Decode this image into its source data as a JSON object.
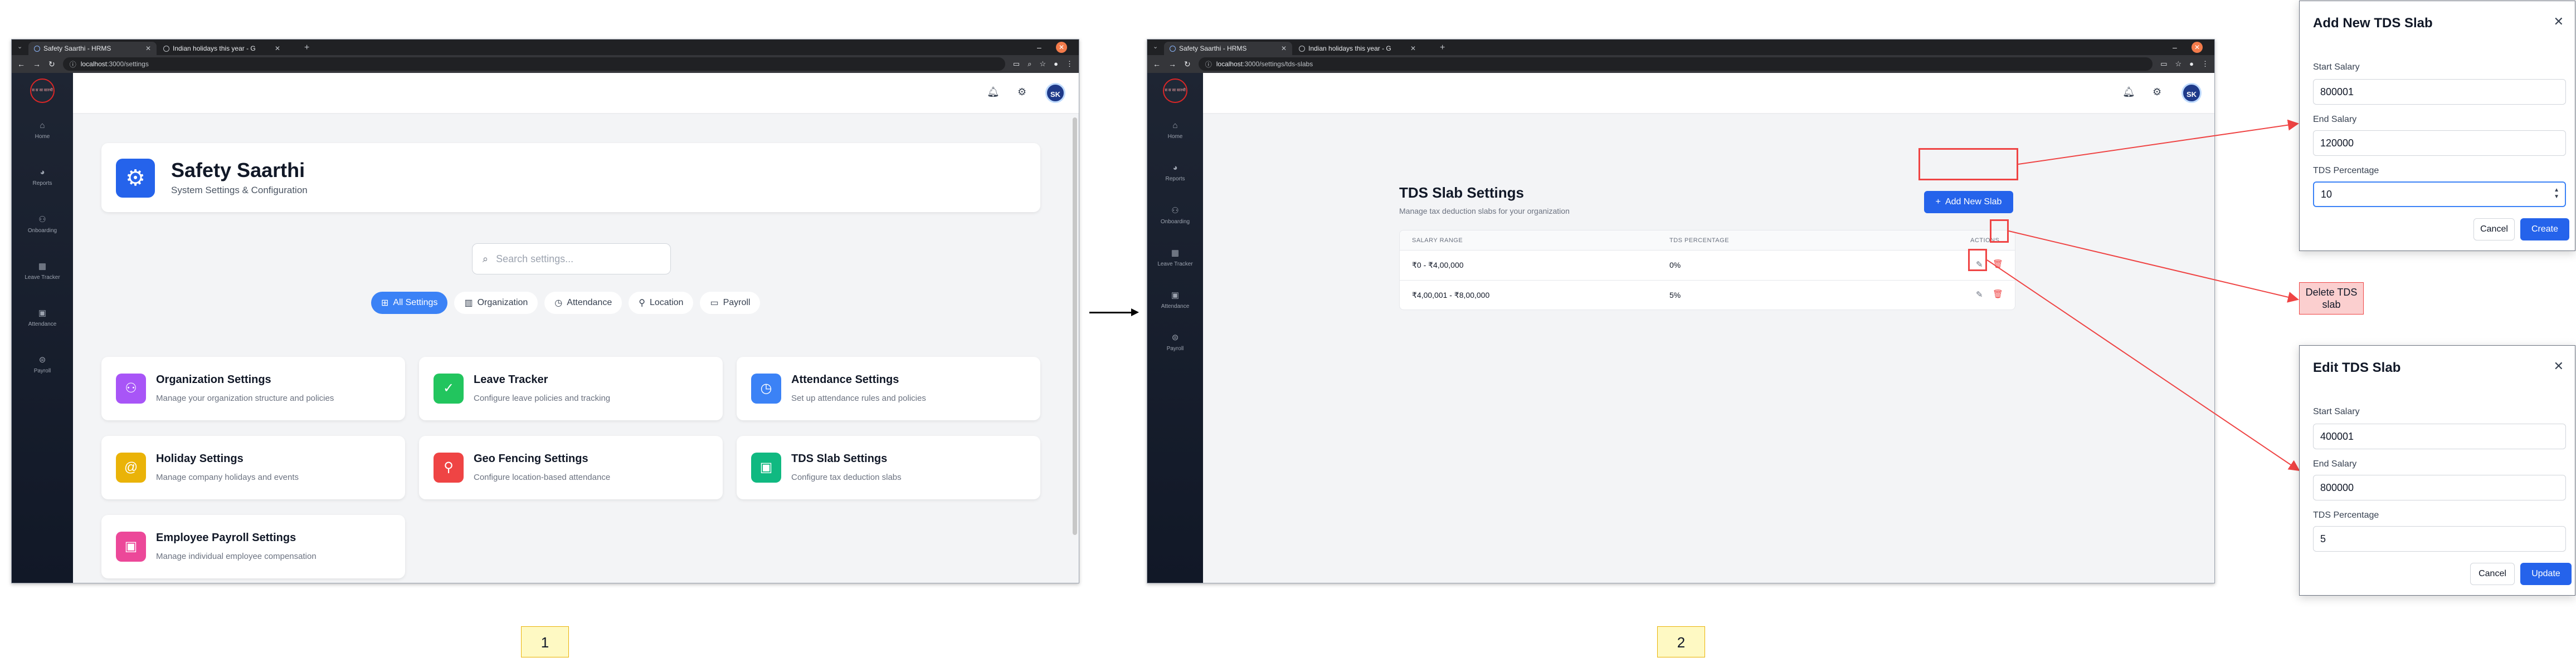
{
  "browser": {
    "tab1": "Safety Saarthi - HRMS",
    "tab2": "Indian holidays this year - G"
  },
  "window1": {
    "url_host": "localhost",
    "url_path": ":3000/settings",
    "sidebar": {
      "logo_text": "स स सा सारथी",
      "items": [
        {
          "label": "Home",
          "icon": "home-icon"
        },
        {
          "label": "Reports",
          "icon": "pie-chart-icon"
        },
        {
          "label": "Onboarding",
          "icon": "users-icon"
        },
        {
          "label": "Leave Tracker",
          "icon": "calendar-icon"
        },
        {
          "label": "Attendance",
          "icon": "calendar-check-icon"
        },
        {
          "label": "Payroll",
          "icon": "money-icon"
        }
      ]
    },
    "avatar": "SK",
    "hero": {
      "title": "Safety Saarthi",
      "subtitle": "System Settings & Configuration"
    },
    "search_placeholder": "Search settings...",
    "filters": [
      "All Settings",
      "Organization",
      "Attendance",
      "Location",
      "Payroll"
    ],
    "cards": [
      {
        "title": "Organization Settings",
        "desc": "Manage your organization structure and policies",
        "color": "#a855f7"
      },
      {
        "title": "Leave Tracker",
        "desc": "Configure leave policies and tracking",
        "color": "#22c55e"
      },
      {
        "title": "Attendance Settings",
        "desc": "Set up attendance rules and policies",
        "color": "#3b82f6"
      },
      {
        "title": "Holiday Settings",
        "desc": "Manage company holidays and events",
        "color": "#eab308"
      },
      {
        "title": "Geo Fencing Settings",
        "desc": "Configure location-based attendance",
        "color": "#ef4444"
      },
      {
        "title": "TDS Slab Settings",
        "desc": "Configure tax deduction slabs",
        "color": "#10b981"
      },
      {
        "title": "Employee Payroll Settings",
        "desc": "Manage individual employee compensation",
        "color": "#ec4899"
      }
    ]
  },
  "window2": {
    "url_host": "localhost",
    "url_path": ":3000/settings/tds-slabs",
    "avatar": "SK",
    "title": "TDS Slab Settings",
    "subtitle": "Manage tax deduction slabs for your organization",
    "add_button": "Add New Slab",
    "table": {
      "headers": [
        "SALARY RANGE",
        "TDS PERCENTAGE",
        "ACTIONS"
      ],
      "rows": [
        {
          "range": "₹0 - ₹4,00,000",
          "pct": "0%"
        },
        {
          "range": "₹4,00,001 - ₹8,00,000",
          "pct": "5%"
        }
      ]
    }
  },
  "add_dialog": {
    "title": "Add New TDS Slab",
    "start_label": "Start Salary",
    "start_value": "800001",
    "end_label": "End Salary",
    "end_value": "120000",
    "pct_label": "TDS Percentage",
    "pct_value": "10",
    "cancel": "Cancel",
    "submit": "Create"
  },
  "edit_dialog": {
    "title": "Edit TDS Slab",
    "start_label": "Start Salary",
    "start_value": "400001",
    "end_label": "End Salary",
    "end_value": "800000",
    "pct_label": "TDS Percentage",
    "pct_value": "5",
    "cancel": "Cancel",
    "submit": "Update"
  },
  "delete_note": "Delete TDS slab",
  "steps": [
    "1",
    "2"
  ],
  "colors": {
    "primary": "#2563eb",
    "annotation": "#ef4444"
  }
}
